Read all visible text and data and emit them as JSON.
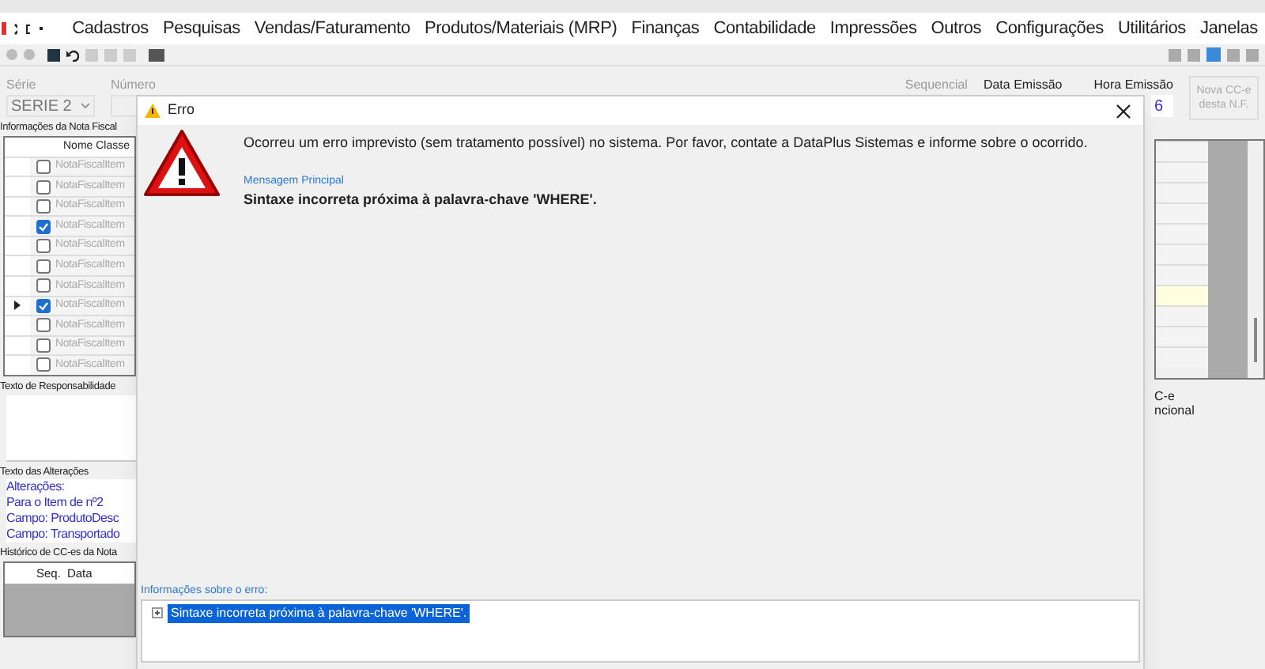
{
  "menu": [
    "Cadastros",
    "Pesquisas",
    "Vendas/Faturamento",
    "Produtos/Materiais (MRP)",
    "Finanças",
    "Contabilidade",
    "Impressões",
    "Outros",
    "Configurações",
    "Utilitários",
    "Janelas"
  ],
  "form": {
    "serie_label": "Série",
    "serie_value": "SERIE 2",
    "numero_label": "Número",
    "sequencial_label": "Sequencial",
    "data_label": "Data Emissão",
    "hora_label": "Hora Emissão",
    "hora_value": "6",
    "new_button": "Nova CC-e desta N.F."
  },
  "items_panel": {
    "title": "Informações da Nota Fiscal",
    "column": "Nome Classe",
    "rows": [
      {
        "name": "NotaFiscalItem",
        "checked": false,
        "current": false
      },
      {
        "name": "NotaFiscalItem",
        "checked": false,
        "current": false
      },
      {
        "name": "NotaFiscalItem",
        "checked": false,
        "current": false
      },
      {
        "name": "NotaFiscalItem",
        "checked": true,
        "current": false
      },
      {
        "name": "NotaFiscalItem",
        "checked": false,
        "current": false
      },
      {
        "name": "NotaFiscalItem",
        "checked": false,
        "current": false
      },
      {
        "name": "NotaFiscalItem",
        "checked": false,
        "current": false
      },
      {
        "name": "NotaFiscalItem",
        "checked": true,
        "current": true
      },
      {
        "name": "NotaFiscalItem",
        "checked": false,
        "current": false
      },
      {
        "name": "NotaFiscalItem",
        "checked": false,
        "current": false
      },
      {
        "name": "NotaFiscalItem",
        "checked": false,
        "current": false
      }
    ]
  },
  "responsabilidade_title": "Texto de Responsabilidade",
  "alteracoes": {
    "title": "Texto das Alterações",
    "lines": [
      "Alterações:",
      "Para o Item de nº2",
      "Campo: ProdutoDesc",
      "Campo: Transportado"
    ]
  },
  "historico": {
    "title": "Histórico de CC-es da Nota",
    "columns": [
      "Seq.",
      "Data"
    ]
  },
  "right_fragments": [
    "C-e",
    "ncional"
  ],
  "dialog": {
    "title": "Erro",
    "message": "Ocorreu um erro imprevisto (sem tratamento possível) no sistema. Por favor, contate a DataPlus Sistemas e informe sobre o ocorrido.",
    "main_label": "Mensagem Principal",
    "main_message": "Sintaxe incorreta próxima à palavra-chave 'WHERE'.",
    "details_label": "Informações sobre o erro:",
    "details_item": "Sintaxe incorreta próxima à palavra-chave 'WHERE'."
  }
}
